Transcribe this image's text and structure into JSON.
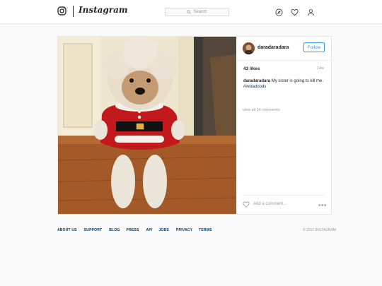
{
  "header": {
    "wordmark": "Instagram",
    "search_placeholder": "Search",
    "icons": [
      "instagram-glyph-icon",
      "search-icon",
      "compass-icon",
      "heart-icon",
      "person-icon"
    ]
  },
  "post": {
    "username": "daradaradara",
    "follow_label": "Follow",
    "likes": "43 likes",
    "time": "14w",
    "caption_user": "daradaradara",
    "caption_text": "My sister is going to kill me.",
    "hashtag": "#instadoods",
    "view_comments": "view all 14 comments",
    "add_comment_placeholder": "Add a comment...",
    "more_icon": "more-dots-icon"
  },
  "footer": {
    "links": [
      "ABOUT US",
      "SUPPORT",
      "BLOG",
      "PRESS",
      "API",
      "JOBS",
      "PRIVACY",
      "TERMS"
    ],
    "copyright": "© 2017 INSTAGRAM"
  },
  "colors": {
    "link_blue": "#3897f0",
    "hashtag_blue": "#003569",
    "muted": "#999999",
    "border": "#e6e6e6"
  }
}
